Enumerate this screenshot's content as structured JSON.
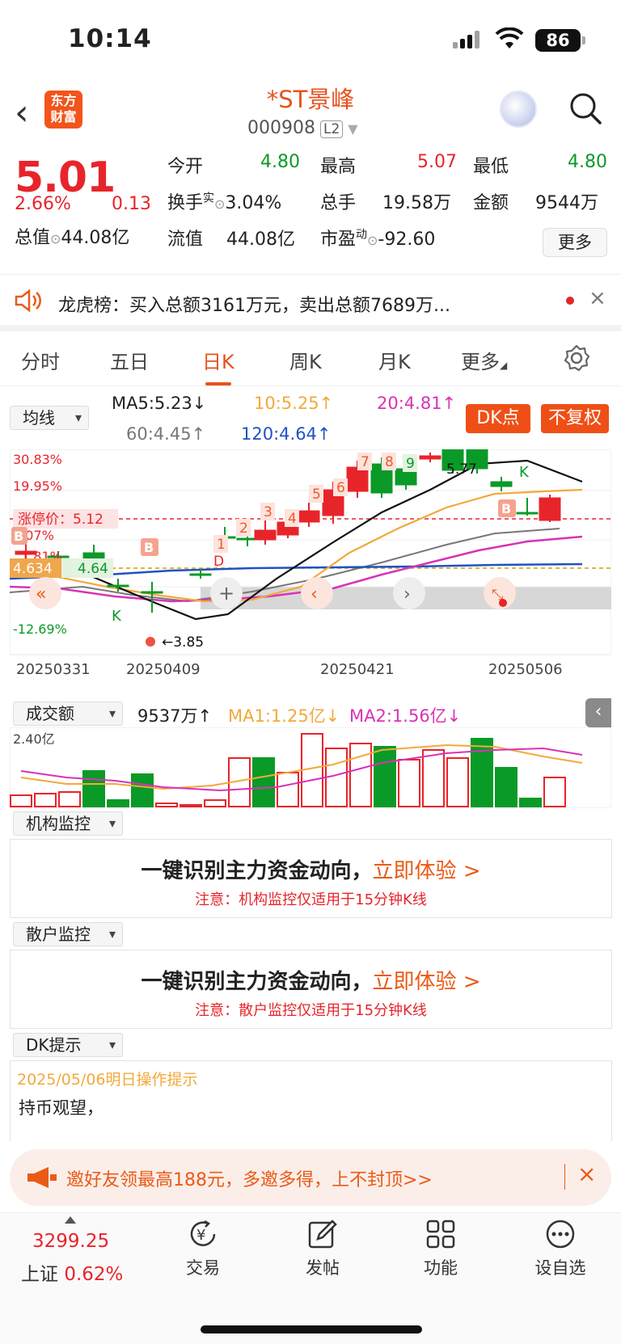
{
  "status": {
    "time": "10:14",
    "battery": "86"
  },
  "header": {
    "back": "‹",
    "logo": "东方财富",
    "title": "*ST景峰",
    "code": "000908",
    "level": "L2"
  },
  "quote": {
    "price": "5.01",
    "pct": "2.66%",
    "change": "0.13",
    "open_label": "今开",
    "open": "4.80",
    "high_label": "最高",
    "high": "5.07",
    "low_label": "最低",
    "low": "4.80",
    "turnover_label": "换手",
    "turnover_sup": "实",
    "turnover": "3.04%",
    "volume_label": "总手",
    "volume": "19.58万",
    "amount_label": "金额",
    "amount": "9544万",
    "mcap_label": "总值",
    "mcap": "44.08亿",
    "float_label": "流值",
    "float": "44.08亿",
    "pe_label": "市盈",
    "pe_sup": "动",
    "pe": "-92.60",
    "more": "更多"
  },
  "notice": {
    "text": "龙虎榜：买入总额3161万元，卖出总额7689万...",
    "close": "×"
  },
  "tabs": [
    "分时",
    "五日",
    "日K",
    "周K",
    "月K",
    "更多"
  ],
  "active_tab": "日K",
  "ma": {
    "selector": "均线",
    "ma5": "MA5:5.23↓",
    "ma10": "10:5.25↑",
    "ma20": "20:4.81↑",
    "ma60": "60:4.45↑",
    "ma120": "120:4.64↑",
    "dk": "DK点",
    "fq": "不复权"
  },
  "kline": {
    "y_labels": [
      "30.83%",
      "19.95%",
      "9.07%",
      "1.81%",
      "-12.69%"
    ],
    "limit_label": "涨停价：5.12",
    "cur_label": "4.634",
    "cur_value": "4.64",
    "high_mark": "5.77",
    "low_mark": "←3.85",
    "dates": [
      "20250331",
      "20250409",
      "20250421",
      "20250506"
    ],
    "labels": [
      "1",
      "2",
      "3",
      "4",
      "5",
      "6",
      "7",
      "8",
      "9"
    ],
    "k_marks": [
      "K",
      "K"
    ],
    "b_marks": [
      "B",
      "B",
      "B"
    ],
    "d_mark": "D"
  },
  "volume": {
    "selector": "成交额",
    "value": "9537万↑",
    "ma1": "MA1:1.25亿↓",
    "ma2": "MA2:1.56亿↓",
    "max": "2.40亿"
  },
  "panels": [
    {
      "selector": "机构监控",
      "title": "一键识别主力资金动向，",
      "cta": "立即体验 >",
      "note": "注意：机构监控仅适用于15分钟K线"
    },
    {
      "selector": "散户监控",
      "title": "一键识别主力资金动向，",
      "cta": "立即体验 >",
      "note": "注意：散户监控仅适用于15分钟K线"
    }
  ],
  "dk": {
    "selector": "DK提示",
    "date": "2025/05/06明日操作提示",
    "text": "持币观望，"
  },
  "banner": {
    "text": "邀好友领最高188元，多邀多得，上不封顶>>",
    "close": "×"
  },
  "bottom": {
    "index_value": "3299.25",
    "index_name": "上证",
    "index_pct": "0.62%",
    "nav": [
      "交易",
      "发帖",
      "功能",
      "设自选"
    ]
  },
  "colors": {
    "accent": "#ea5a16",
    "up": "#e8242b",
    "down": "#0a9a27"
  }
}
